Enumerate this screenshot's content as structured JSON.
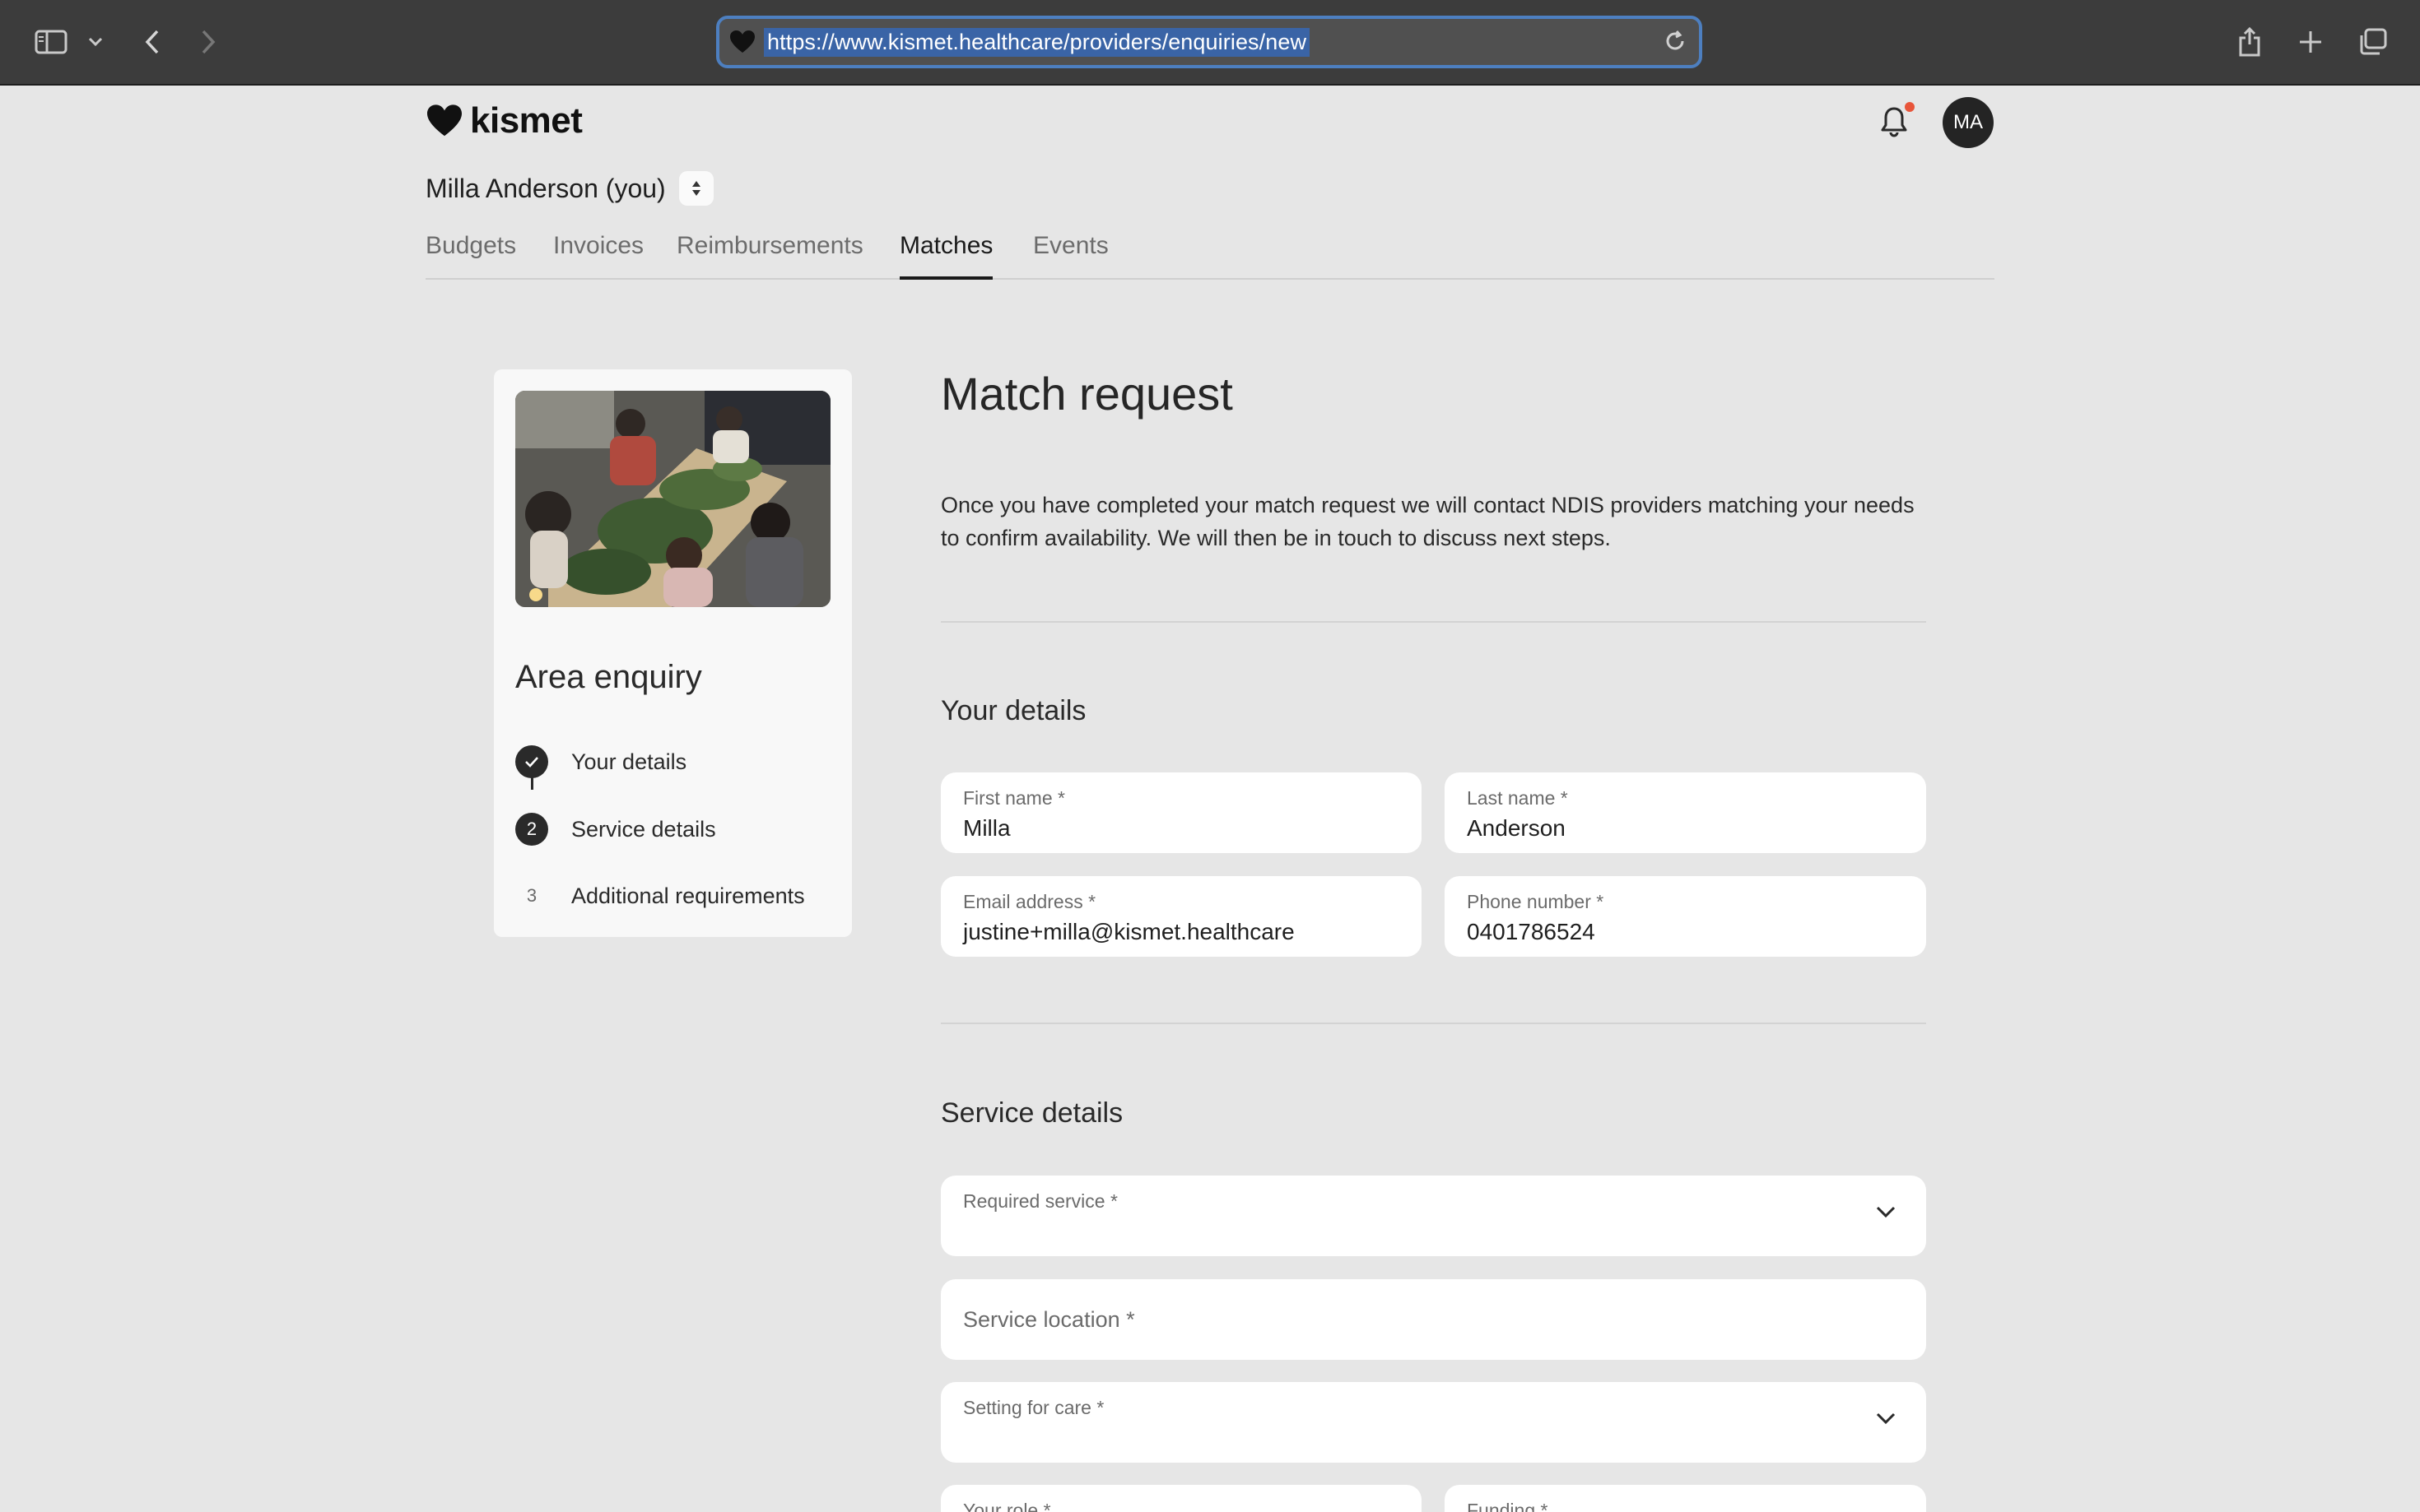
{
  "browser": {
    "url": "https://www.kismet.healthcare/providers/enquiries/new"
  },
  "header": {
    "brand": "kismet",
    "avatar_initials": "MA",
    "account_name": "Milla Anderson (you)",
    "notification_dot_color": "#e8553a"
  },
  "tabs": [
    {
      "label": "Budgets",
      "active": false
    },
    {
      "label": "Invoices",
      "active": false
    },
    {
      "label": "Reimbursements",
      "active": false
    },
    {
      "label": "Matches",
      "active": true
    },
    {
      "label": "Events",
      "active": false
    }
  ],
  "sidebar": {
    "title": "Area enquiry",
    "steps": [
      {
        "number": "",
        "label": "Your details",
        "state": "completed"
      },
      {
        "number": "2",
        "label": "Service details",
        "state": "current"
      },
      {
        "number": "3",
        "label": "Additional requirements",
        "state": "upcoming"
      }
    ]
  },
  "main": {
    "title": "Match request",
    "intro": "Once you have completed your match request we will contact NDIS providers matching your needs to confirm availability. We will then be in touch to discuss next steps.",
    "your_details": {
      "heading": "Your details",
      "first_name": {
        "label": "First name *",
        "value": "Milla"
      },
      "last_name": {
        "label": "Last name *",
        "value": "Anderson"
      },
      "email": {
        "label": "Email address *",
        "value": "justine+milla@kismet.healthcare"
      },
      "phone": {
        "label": "Phone number *",
        "value": "0401786524"
      }
    },
    "service_details": {
      "heading": "Service details",
      "required_service": {
        "label": "Required service *",
        "value": ""
      },
      "service_location": {
        "placeholder": "Service location *"
      },
      "setting_for_care": {
        "label": "Setting for care *",
        "value": ""
      },
      "your_role": {
        "label": "Your role *"
      },
      "funding": {
        "label": "Funding *"
      }
    }
  },
  "colors": {
    "page_bg": "#e6e6e6",
    "accent_dark": "#242424",
    "url_highlight": "#3a64a6"
  }
}
